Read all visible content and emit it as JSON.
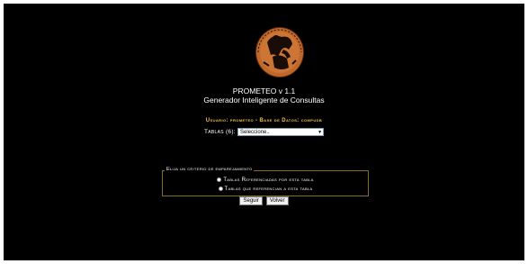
{
  "header": {
    "title": "PROMETEO v 1.1",
    "subtitle": "Generador Inteligente de Consultas",
    "logo": "prometeo-greek-vase-logo"
  },
  "session": {
    "user_line": "Usuario: prometeo - Base de Datos: compudb"
  },
  "tables": {
    "label": "Tablas (6):",
    "selected": "Seleccione.."
  },
  "criteria": {
    "legend": "Elija un criterio de emparejamiento",
    "options": [
      {
        "label": "Tablas Referenciadas por esta tabla",
        "checked": false
      },
      {
        "label": "Tablas que referencian a esta tabla",
        "checked": false
      }
    ]
  },
  "actions": {
    "next_label": "Seguir",
    "back_label": "Volver"
  },
  "colors": {
    "background": "#000000",
    "accent": "#f0c040",
    "fieldset_border": "#8a6d1e"
  }
}
